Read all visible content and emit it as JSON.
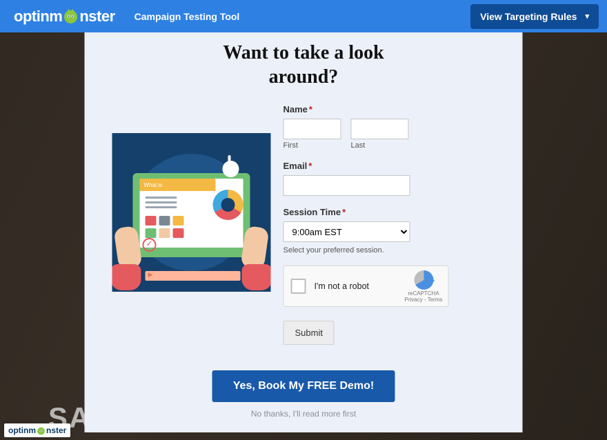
{
  "topbar": {
    "brand_pre": "optinm",
    "brand_post": "nster",
    "tool_name": "Campaign Testing Tool",
    "targeting_btn": "View Targeting Rules"
  },
  "modal": {
    "title_line1": "Want to take a look",
    "title_line2": "around?",
    "illus_searchbar": "What is",
    "form": {
      "name_label": "Name",
      "first_sub": "First",
      "last_sub": "Last",
      "email_label": "Email",
      "session_label": "Session Time",
      "session_selected": "9:00am EST",
      "session_helper": "Select your preferred session.",
      "required_mark": "*",
      "recaptcha_text": "I'm not a robot",
      "recaptcha_brand": "reCAPTCHA",
      "recaptcha_privacy": "Privacy",
      "recaptcha_terms": "Terms",
      "submit_label": "Submit"
    },
    "cta_label": "Yes, Book My FREE Demo!",
    "decline_label": "No thanks, I'll read more first"
  },
  "background": {
    "sample_text": "SA"
  },
  "footer_badge": {
    "brand_pre": "optinm",
    "brand_post": "nster"
  }
}
